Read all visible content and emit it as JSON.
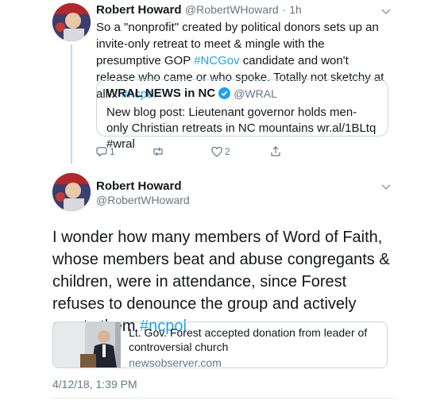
{
  "tweet1": {
    "author_name": "Robert Howard",
    "author_handle": "@RobertWHoward",
    "separator": "·",
    "time": "1h",
    "text_before": "So a \"nonprofit\" created by political donors sets up an invite-only retreat to meet & mingle with the presumptive GOP ",
    "hashtag1": "#NCGov",
    "text_middle": " candidate and won't release who came or who spoke. Totally not sketchy at all... ",
    "hashtag2": "#ncpol",
    "quoted": {
      "name": "WRAL NEWS in NC",
      "handle": "@WRAL",
      "text": "New blog post: Lieutenant governor holds men-only Christian retreats in NC mountains wr.al/1BLtq #wral"
    },
    "actions": {
      "reply_count": "1",
      "retweet_count": "",
      "like_count": "2"
    }
  },
  "tweet2": {
    "author_name": "Robert Howard",
    "author_handle": "@RobertWHoward",
    "text": "I wonder how many members of Word of Faith, whose members beat and abuse congregants & children, were in attendance, since Forest refuses to denounce the group and actively courts them ",
    "hashtag": "#ncpol",
    "card": {
      "title": "Lt. Gov. Forest accepted donation from leader of controversial church",
      "domain": "newsobserver.com"
    },
    "timestamp": "4/12/18, 1:39 PM"
  },
  "colors": {
    "link": "#1da1f2",
    "verified": "#1da1f2",
    "muted": "#657786",
    "border": "#ccd6dd"
  }
}
